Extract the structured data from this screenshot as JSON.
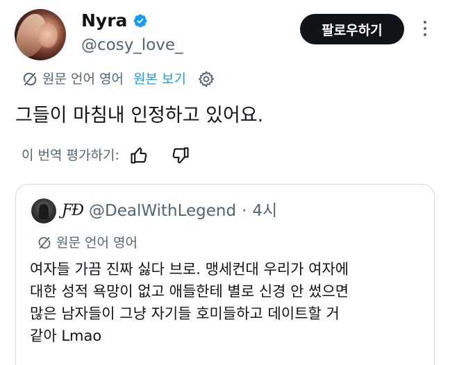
{
  "author": {
    "name": "Nyra",
    "handle": "@cosy_love_"
  },
  "follow_label": "팔로우하기",
  "translation": {
    "source_label": "원문 언어 영어",
    "view_original": "원본 보기"
  },
  "tweet_text": "그들이 마침내 인정하고 있어요.",
  "rate_label": "이 번역 평가하기:",
  "quote": {
    "monogram": "ƑĐ",
    "handle": "@DealWithLegend",
    "separator": "·",
    "time": "4시",
    "source_label": "원문 언어 영어",
    "lines": [
      "여자들 가끔 진짜 싫다 브로. 맹세컨대 우리가 여자에",
      "대한 성적 욕망이 없고 애들한테 별로 신경 안 썼으면",
      "많은 남자들이 그냥 자기들 호미들하고 데이트할 거",
      "같아 Lmao"
    ]
  },
  "icons": [
    "verified-badge-icon",
    "more-icon",
    "translate-icon",
    "settings-gear-icon",
    "thumbs-up-icon",
    "thumbs-down-icon"
  ],
  "colors": {
    "accent": "#1d9bf0",
    "text": "#0f1419",
    "muted": "#536471",
    "border": "#cfd9de",
    "button_bg": "#0f1419"
  }
}
